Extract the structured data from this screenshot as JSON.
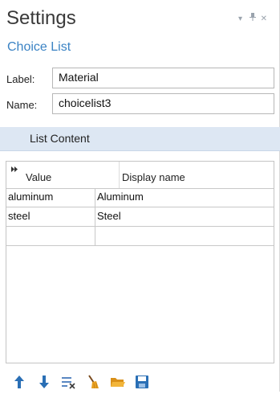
{
  "header": {
    "title": "Settings",
    "subtitle": "Choice List"
  },
  "form": {
    "label_label": "Label:",
    "label_value": "Material",
    "name_label": "Name:",
    "name_value": "choicelist3"
  },
  "section": {
    "title": "List Content"
  },
  "table": {
    "columns": [
      "Value",
      "Display name"
    ],
    "rows": [
      [
        "aluminum",
        "Aluminum"
      ],
      [
        "steel",
        "Steel"
      ],
      [
        "",
        ""
      ]
    ]
  },
  "toolbar": {
    "icons": [
      "move-up-icon",
      "move-down-icon",
      "delete-icon",
      "clear-table-icon",
      "load-from-file-icon",
      "save-to-file-icon"
    ]
  },
  "colors": {
    "accent": "#3b83c4",
    "section_bg": "#dde7f3",
    "arrow_blue": "#2a6fb5",
    "folder": "#e8a020"
  }
}
